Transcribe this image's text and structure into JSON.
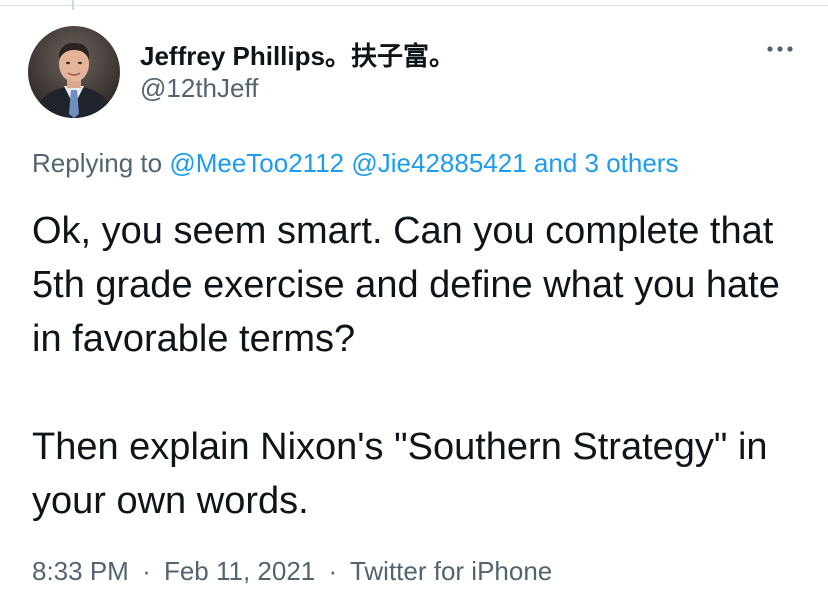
{
  "author": {
    "display_name": "Jeffrey Phillips。扶子富。",
    "handle": "@12thJeff",
    "avatar_icon": "profile-photo-man-in-suit"
  },
  "more_icon": "more-horizontal-icon",
  "reply_context": {
    "prefix": "Replying to",
    "mentions": [
      "@MeeToo2112",
      "@Jie42885421"
    ],
    "others_label": "and 3 others"
  },
  "tweet": {
    "paragraph_1": "Ok, you seem smart. Can you complete that 5th grade exercise and define what you hate in favorable terms?",
    "paragraph_2": "Then explain Nixon's \"Southern Strategy\" in your own words."
  },
  "meta": {
    "time": "8:33 PM",
    "separator": "·",
    "date": "Feb 11, 2021",
    "source": "Twitter for iPhone"
  },
  "colors": {
    "link": "#1d9bf0",
    "secondary_text": "#536471",
    "primary_text": "#0f1419"
  }
}
